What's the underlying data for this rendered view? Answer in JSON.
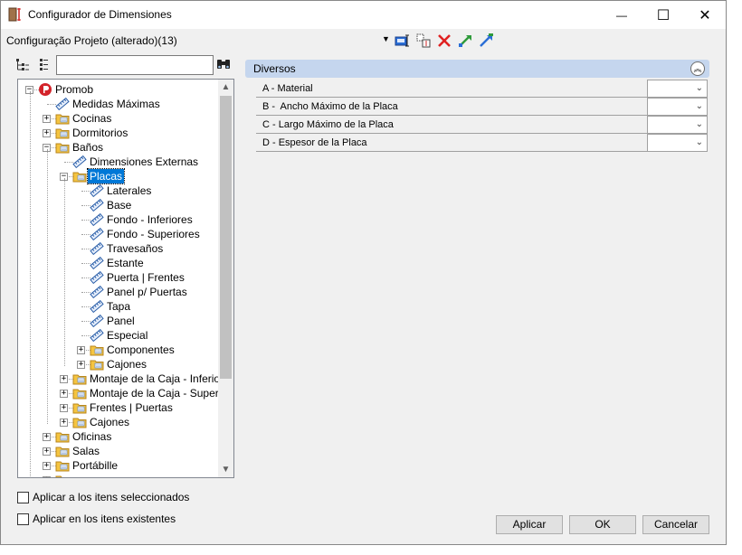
{
  "window": {
    "title": "Configurador de Dimensiones",
    "controls": {
      "minimize": "—",
      "maximize": "☐",
      "close": "✕"
    }
  },
  "toolbar": {
    "config_label": "Configuração Projeto (alterado)(13)",
    "dropdown_glyph": "▼",
    "icons": [
      "save-config-icon",
      "copy-config-icon",
      "delete-icon",
      "import-icon",
      "export-icon"
    ]
  },
  "tree_toolbar": {
    "search_value": "",
    "search_placeholder": "",
    "icons": [
      "tree-view-icon",
      "list-view-icon",
      "binoculars-icon"
    ]
  },
  "tree": {
    "items": [
      {
        "label": "Promob",
        "level": 0,
        "expander": "−",
        "icon": "promob-logo-icon"
      },
      {
        "label": "Medidas Máximas",
        "level": 1,
        "expander": "",
        "icon": "ruler-icon"
      },
      {
        "label": "Cocinas",
        "level": 1,
        "expander": "+",
        "icon": "folder-icon"
      },
      {
        "label": "Dormitorios",
        "level": 1,
        "expander": "+",
        "icon": "folder-icon"
      },
      {
        "label": "Baños",
        "level": 1,
        "expander": "−",
        "icon": "folder-icon"
      },
      {
        "label": "Dimensiones Externas",
        "level": 2,
        "expander": "",
        "icon": "ruler-icon"
      },
      {
        "label": "Placas",
        "level": 2,
        "expander": "−",
        "icon": "folder-icon",
        "selected": true
      },
      {
        "label": "Laterales",
        "level": 3,
        "expander": "",
        "icon": "ruler-icon"
      },
      {
        "label": "Base",
        "level": 3,
        "expander": "",
        "icon": "ruler-icon"
      },
      {
        "label": "Fondo - Inferiores",
        "level": 3,
        "expander": "",
        "icon": "ruler-icon"
      },
      {
        "label": "Fondo - Superiores",
        "level": 3,
        "expander": "",
        "icon": "ruler-icon"
      },
      {
        "label": "Travesaños",
        "level": 3,
        "expander": "",
        "icon": "ruler-icon"
      },
      {
        "label": "Estante",
        "level": 3,
        "expander": "",
        "icon": "ruler-icon"
      },
      {
        "label": "Puerta | Frentes",
        "level": 3,
        "expander": "",
        "icon": "ruler-icon"
      },
      {
        "label": "Panel p/ Puertas",
        "level": 3,
        "expander": "",
        "icon": "ruler-icon"
      },
      {
        "label": "Tapa",
        "level": 3,
        "expander": "",
        "icon": "ruler-icon"
      },
      {
        "label": "Panel",
        "level": 3,
        "expander": "",
        "icon": "ruler-icon"
      },
      {
        "label": "Especial",
        "level": 3,
        "expander": "",
        "icon": "ruler-icon"
      },
      {
        "label": "Componentes",
        "level": 3,
        "expander": "+",
        "icon": "folder-icon"
      },
      {
        "label": "Cajones",
        "level": 3,
        "expander": "+",
        "icon": "folder-icon"
      },
      {
        "label": "Montaje de la Caja - Inferior",
        "level": 2,
        "expander": "+",
        "icon": "folder-icon"
      },
      {
        "label": "Montaje de la Caja - Superior",
        "level": 2,
        "expander": "+",
        "icon": "folder-icon"
      },
      {
        "label": "Frentes | Puertas",
        "level": 2,
        "expander": "+",
        "icon": "folder-icon"
      },
      {
        "label": "Cajones",
        "level": 2,
        "expander": "+",
        "icon": "folder-icon"
      },
      {
        "label": "Oficinas",
        "level": 1,
        "expander": "+",
        "icon": "folder-icon"
      },
      {
        "label": "Salas",
        "level": 1,
        "expander": "+",
        "icon": "folder-icon"
      },
      {
        "label": "Portábille",
        "level": 1,
        "expander": "+",
        "icon": "folder-icon"
      },
      {
        "label": "",
        "level": 1,
        "expander": "+",
        "icon": "folder-icon"
      }
    ],
    "scroll_up": "▲",
    "scroll_down": "▼"
  },
  "properties": {
    "section_title": "Diversos",
    "collapse_glyph": "︽",
    "rows": [
      {
        "label": "A - Material",
        "value": ""
      },
      {
        "label": "B -  Ancho Máximo de la Placa",
        "value": ""
      },
      {
        "label": "C - Largo Máximo de la Placa",
        "value": ""
      },
      {
        "label": "D - Espesor de la Placa",
        "value": ""
      }
    ],
    "chevron": "⌄"
  },
  "options": {
    "apply_selected": "Aplicar a los itens seleccionados",
    "apply_existing": "Aplicar en los itens existentes"
  },
  "buttons": {
    "apply": "Aplicar",
    "ok": "OK",
    "cancel": "Cancelar"
  },
  "colors": {
    "selection": "#0078d7",
    "section_header": "#c5d6ee",
    "folder": "#f5c440",
    "delete_red": "#e02020",
    "arrow_green": "#2e9a3a",
    "arrow_blue": "#2a6ed6"
  }
}
